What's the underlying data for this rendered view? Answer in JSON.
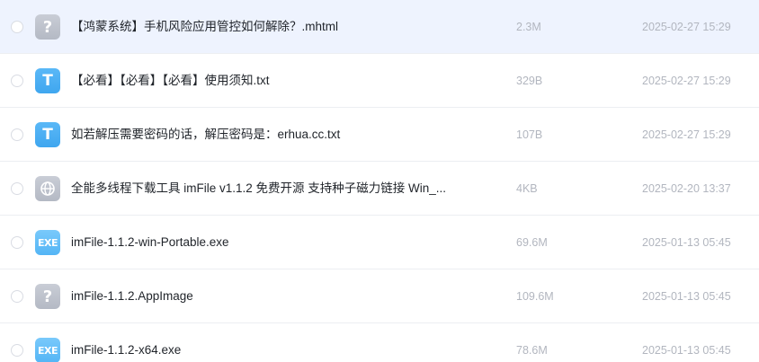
{
  "icons": {
    "unknown": {
      "name": "unknown-file-icon",
      "glyph": "?"
    },
    "text": {
      "name": "text-file-icon",
      "glyph": "T"
    },
    "exe": {
      "name": "exe-file-icon",
      "glyph": "EXE"
    },
    "web": {
      "name": "globe-icon"
    }
  },
  "colors": {
    "selected_row_bg": "#eef3fe",
    "text_icon": "#3fa6ef",
    "exe_icon": "#54b5f5",
    "unknown_icon": "#b4b9c4",
    "meta_text": "#b2b6bf"
  },
  "files": [
    {
      "name": "【鸿蒙系统】手机风险应用管控如何解除？.mhtml",
      "size": "2.3M",
      "date": "2025-02-27 15:29",
      "icon": "unknown",
      "selected": true
    },
    {
      "name": "【必看】【必看】【必看】使用须知.txt",
      "size": "329B",
      "date": "2025-02-27 15:29",
      "icon": "text",
      "selected": false
    },
    {
      "name": "如若解压需要密码的话，解压密码是：erhua.cc.txt",
      "size": "107B",
      "date": "2025-02-27 15:29",
      "icon": "text",
      "selected": false
    },
    {
      "name": "全能多线程下载工具 imFile v1.1.2 免费开源 支持种子磁力链接 Win_...",
      "size": "4KB",
      "date": "2025-02-20 13:37",
      "icon": "web",
      "selected": false
    },
    {
      "name": "imFile-1.1.2-win-Portable.exe",
      "size": "69.6M",
      "date": "2025-01-13 05:45",
      "icon": "exe",
      "selected": false
    },
    {
      "name": "imFile-1.1.2.AppImage",
      "size": "109.6M",
      "date": "2025-01-13 05:45",
      "icon": "unknown",
      "selected": false
    },
    {
      "name": "imFile-1.1.2-x64.exe",
      "size": "78.6M",
      "date": "2025-01-13 05:45",
      "icon": "exe",
      "selected": false
    }
  ]
}
